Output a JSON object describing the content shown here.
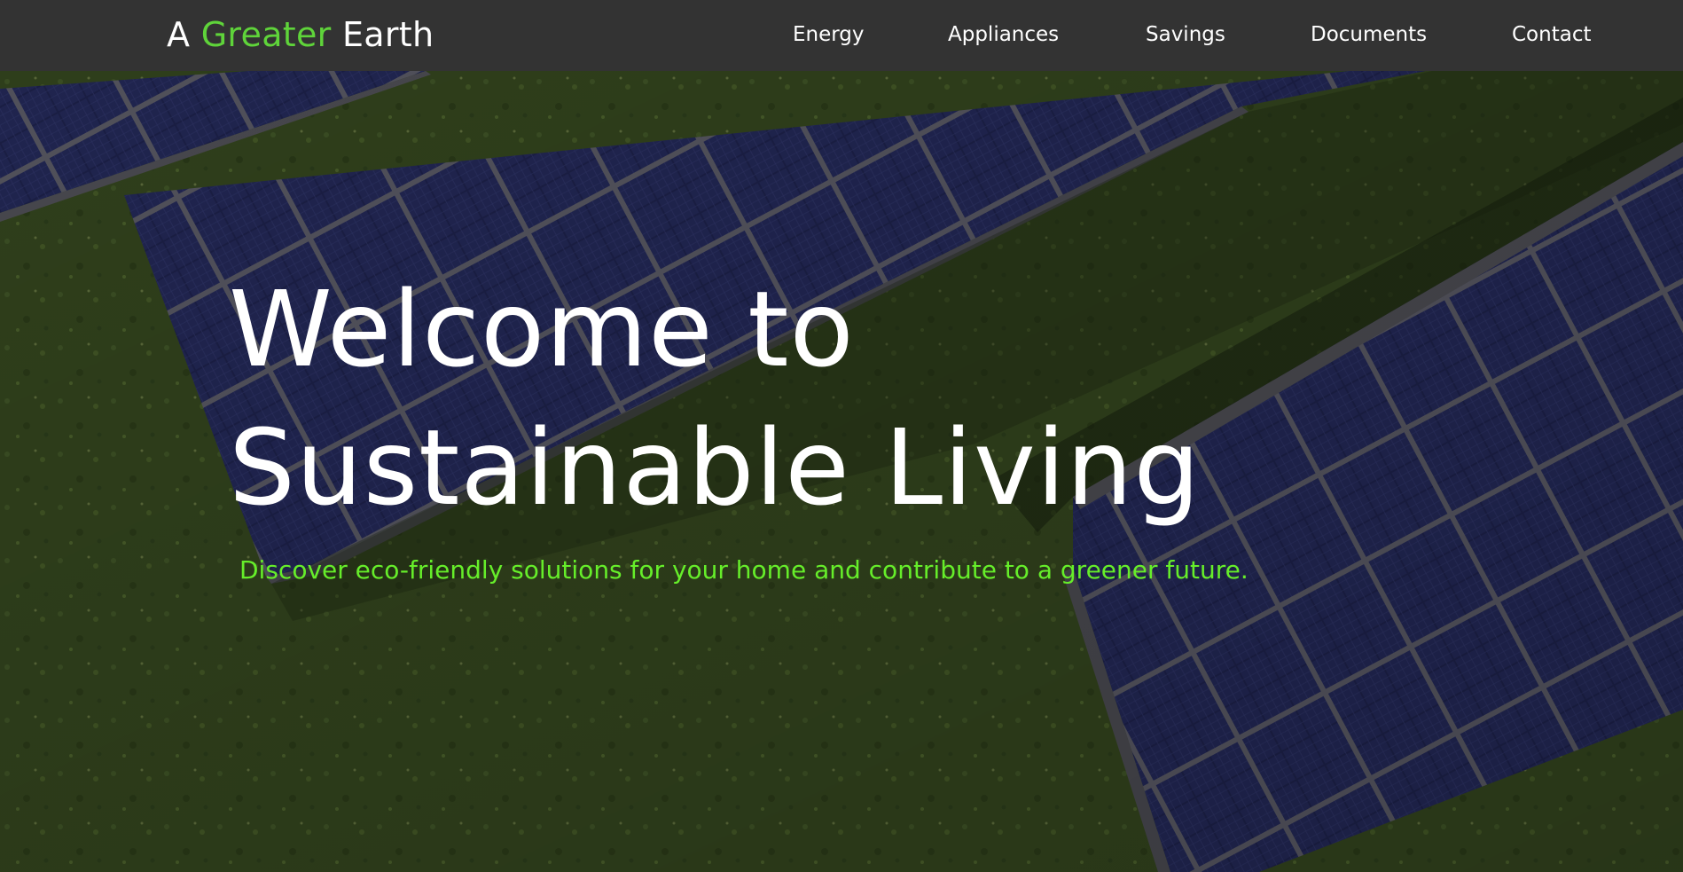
{
  "header": {
    "logo": {
      "part1": "A ",
      "part2": "Greater",
      "part3": " Earth"
    },
    "nav": [
      {
        "label": "Energy"
      },
      {
        "label": "Appliances"
      },
      {
        "label": "Savings"
      },
      {
        "label": "Documents"
      },
      {
        "label": "Contact"
      }
    ]
  },
  "hero": {
    "title_line1": "Welcome to",
    "title_line2": "Sustainable Living",
    "subtitle": "Discover eco-friendly solutions for your home and contribute to a greener future."
  },
  "colors": {
    "header_bg": "#333333",
    "brand_accent": "#5fd43a",
    "subtitle_green": "#66ee2a",
    "text_white": "#ffffff"
  }
}
